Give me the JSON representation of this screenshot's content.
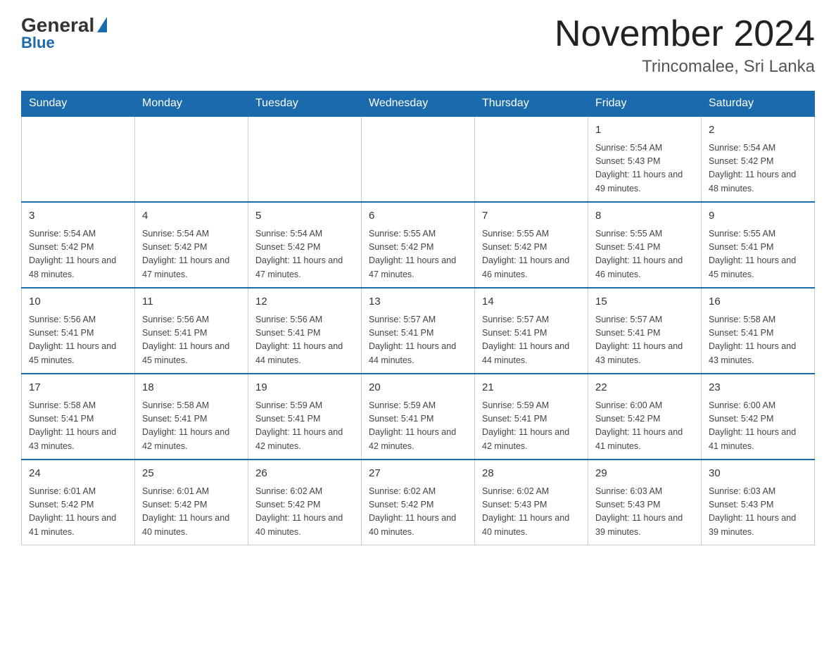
{
  "logo": {
    "general": "General",
    "blue": "Blue"
  },
  "header": {
    "month_year": "November 2024",
    "location": "Trincomalee, Sri Lanka"
  },
  "weekdays": [
    "Sunday",
    "Monday",
    "Tuesday",
    "Wednesday",
    "Thursday",
    "Friday",
    "Saturday"
  ],
  "weeks": [
    [
      {
        "day": "",
        "info": ""
      },
      {
        "day": "",
        "info": ""
      },
      {
        "day": "",
        "info": ""
      },
      {
        "day": "",
        "info": ""
      },
      {
        "day": "",
        "info": ""
      },
      {
        "day": "1",
        "info": "Sunrise: 5:54 AM\nSunset: 5:43 PM\nDaylight: 11 hours\nand 49 minutes."
      },
      {
        "day": "2",
        "info": "Sunrise: 5:54 AM\nSunset: 5:42 PM\nDaylight: 11 hours\nand 48 minutes."
      }
    ],
    [
      {
        "day": "3",
        "info": "Sunrise: 5:54 AM\nSunset: 5:42 PM\nDaylight: 11 hours\nand 48 minutes."
      },
      {
        "day": "4",
        "info": "Sunrise: 5:54 AM\nSunset: 5:42 PM\nDaylight: 11 hours\nand 47 minutes."
      },
      {
        "day": "5",
        "info": "Sunrise: 5:54 AM\nSunset: 5:42 PM\nDaylight: 11 hours\nand 47 minutes."
      },
      {
        "day": "6",
        "info": "Sunrise: 5:55 AM\nSunset: 5:42 PM\nDaylight: 11 hours\nand 47 minutes."
      },
      {
        "day": "7",
        "info": "Sunrise: 5:55 AM\nSunset: 5:42 PM\nDaylight: 11 hours\nand 46 minutes."
      },
      {
        "day": "8",
        "info": "Sunrise: 5:55 AM\nSunset: 5:41 PM\nDaylight: 11 hours\nand 46 minutes."
      },
      {
        "day": "9",
        "info": "Sunrise: 5:55 AM\nSunset: 5:41 PM\nDaylight: 11 hours\nand 45 minutes."
      }
    ],
    [
      {
        "day": "10",
        "info": "Sunrise: 5:56 AM\nSunset: 5:41 PM\nDaylight: 11 hours\nand 45 minutes."
      },
      {
        "day": "11",
        "info": "Sunrise: 5:56 AM\nSunset: 5:41 PM\nDaylight: 11 hours\nand 45 minutes."
      },
      {
        "day": "12",
        "info": "Sunrise: 5:56 AM\nSunset: 5:41 PM\nDaylight: 11 hours\nand 44 minutes."
      },
      {
        "day": "13",
        "info": "Sunrise: 5:57 AM\nSunset: 5:41 PM\nDaylight: 11 hours\nand 44 minutes."
      },
      {
        "day": "14",
        "info": "Sunrise: 5:57 AM\nSunset: 5:41 PM\nDaylight: 11 hours\nand 44 minutes."
      },
      {
        "day": "15",
        "info": "Sunrise: 5:57 AM\nSunset: 5:41 PM\nDaylight: 11 hours\nand 43 minutes."
      },
      {
        "day": "16",
        "info": "Sunrise: 5:58 AM\nSunset: 5:41 PM\nDaylight: 11 hours\nand 43 minutes."
      }
    ],
    [
      {
        "day": "17",
        "info": "Sunrise: 5:58 AM\nSunset: 5:41 PM\nDaylight: 11 hours\nand 43 minutes."
      },
      {
        "day": "18",
        "info": "Sunrise: 5:58 AM\nSunset: 5:41 PM\nDaylight: 11 hours\nand 42 minutes."
      },
      {
        "day": "19",
        "info": "Sunrise: 5:59 AM\nSunset: 5:41 PM\nDaylight: 11 hours\nand 42 minutes."
      },
      {
        "day": "20",
        "info": "Sunrise: 5:59 AM\nSunset: 5:41 PM\nDaylight: 11 hours\nand 42 minutes."
      },
      {
        "day": "21",
        "info": "Sunrise: 5:59 AM\nSunset: 5:41 PM\nDaylight: 11 hours\nand 42 minutes."
      },
      {
        "day": "22",
        "info": "Sunrise: 6:00 AM\nSunset: 5:42 PM\nDaylight: 11 hours\nand 41 minutes."
      },
      {
        "day": "23",
        "info": "Sunrise: 6:00 AM\nSunset: 5:42 PM\nDaylight: 11 hours\nand 41 minutes."
      }
    ],
    [
      {
        "day": "24",
        "info": "Sunrise: 6:01 AM\nSunset: 5:42 PM\nDaylight: 11 hours\nand 41 minutes."
      },
      {
        "day": "25",
        "info": "Sunrise: 6:01 AM\nSunset: 5:42 PM\nDaylight: 11 hours\nand 40 minutes."
      },
      {
        "day": "26",
        "info": "Sunrise: 6:02 AM\nSunset: 5:42 PM\nDaylight: 11 hours\nand 40 minutes."
      },
      {
        "day": "27",
        "info": "Sunrise: 6:02 AM\nSunset: 5:42 PM\nDaylight: 11 hours\nand 40 minutes."
      },
      {
        "day": "28",
        "info": "Sunrise: 6:02 AM\nSunset: 5:43 PM\nDaylight: 11 hours\nand 40 minutes."
      },
      {
        "day": "29",
        "info": "Sunrise: 6:03 AM\nSunset: 5:43 PM\nDaylight: 11 hours\nand 39 minutes."
      },
      {
        "day": "30",
        "info": "Sunrise: 6:03 AM\nSunset: 5:43 PM\nDaylight: 11 hours\nand 39 minutes."
      }
    ]
  ]
}
